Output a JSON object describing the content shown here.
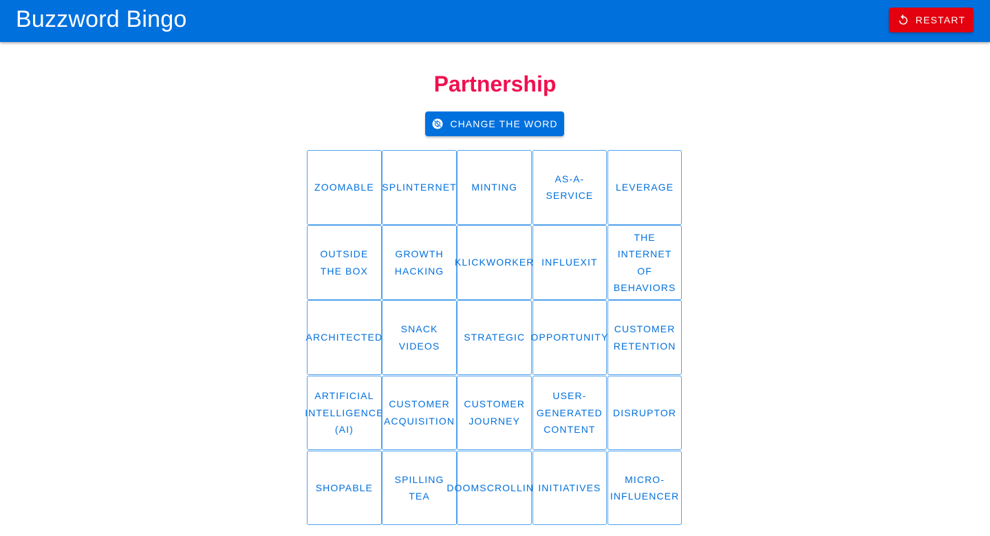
{
  "header": {
    "title": "Buzzword Bingo",
    "restart_label": "Restart",
    "color": "#0070dd",
    "restart_color": "#e3000f"
  },
  "main": {
    "word": "Partnership",
    "word_color": "#f0104f",
    "change_label": "Change the word"
  },
  "board": {
    "rows": [
      [
        "Zoomable",
        "Splinternet",
        "Minting",
        "As-a-service",
        "Leverage"
      ],
      [
        "Outside the box",
        "Growth hacking",
        "Klickworker",
        "Influexit",
        "The internet of behaviors"
      ],
      [
        "Architected",
        "Snack videos",
        "Strategic",
        "Opportunity",
        "Customer retention"
      ],
      [
        "Artificial Intelligence (AI)",
        "Customer acquisition",
        "Customer journey",
        "User-generated content",
        "Disruptor"
      ],
      [
        "Shopable",
        "Spilling tea",
        "Doomscrolling",
        "Initiatives",
        "Micro-influencer"
      ]
    ]
  },
  "icons": {
    "restart": "restart-icon",
    "change": "change-word-icon"
  }
}
